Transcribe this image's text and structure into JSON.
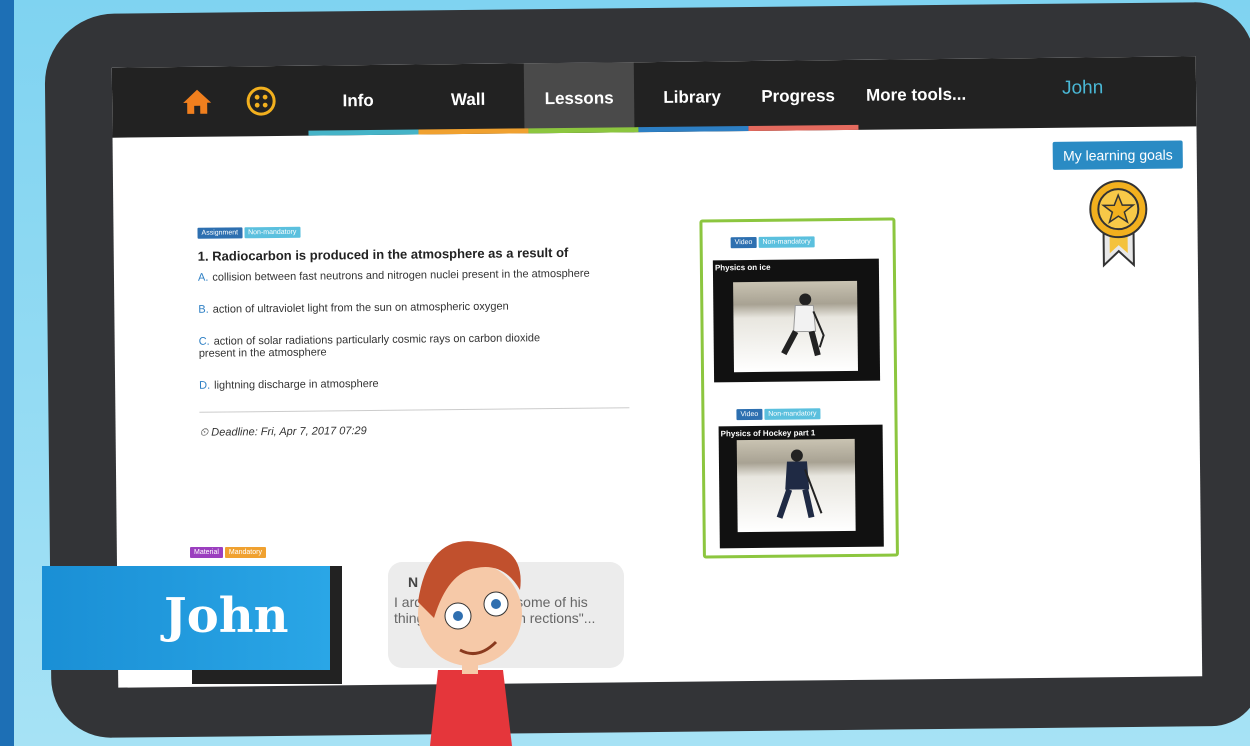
{
  "nav": {
    "info": "Info",
    "wall": "Wall",
    "lessons": "Lessons",
    "library": "Library",
    "progress": "Progress",
    "more": "More tools...",
    "user": "John",
    "stripe_colors": [
      "#45b3c7",
      "#f0a130",
      "#8cc63f",
      "#2d7fc4",
      "#e46a5e",
      "#9b59b6"
    ]
  },
  "goals_button": "My learning goals",
  "assignment": {
    "badge_type": "Assignment",
    "badge_status": "Non-mandatory",
    "question": "1. Radiocarbon is produced in the atmosphere as a result of",
    "options": [
      {
        "letter": "A.",
        "text": "collision between fast neutrons and nitrogen nuclei present in the atmosphere"
      },
      {
        "letter": "B.",
        "text": "action of ultraviolet light from the sun on atmospheric oxygen"
      },
      {
        "letter": "C.",
        "text": "action of solar radiations particularly cosmic rays on carbon dioxide present in the atmosphere"
      },
      {
        "letter": "D.",
        "text": "lightning discharge in atmosphere"
      }
    ],
    "deadline": "Deadline: Fri, Apr 7, 2017 07:29"
  },
  "videos": [
    {
      "badge_type": "Video",
      "badge_status": "Non-mandatory",
      "title": "Physics on ice"
    },
    {
      "badge_type": "Video",
      "badge_status": "Non-mandatory",
      "title": "Physics of Hockey part 1"
    }
  ],
  "material": {
    "badge_type": "Material",
    "badge_status": "Mandatory"
  },
  "bubble": {
    "title": "N",
    "text": "I ard of Isaac Ne of some of his thing about \"equal an rections\"..."
  },
  "banner_name": "John"
}
